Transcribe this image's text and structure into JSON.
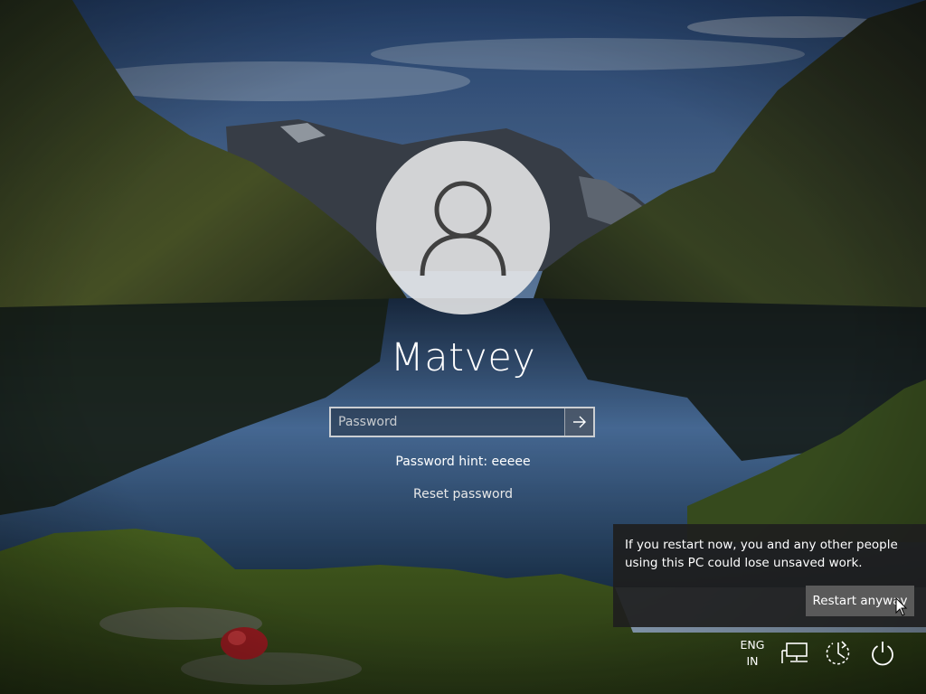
{
  "user": {
    "name": "Matvey"
  },
  "password_field": {
    "placeholder": "Password",
    "value": "",
    "submit_icon": "arrow-right-icon"
  },
  "password_hint": "Password hint: eeeee",
  "reset_password_label": "Reset password",
  "restart_dialog": {
    "message": "If you restart now, you and any other people\nusing this PC could lose unsaved work.",
    "button_label": "Restart anyway"
  },
  "tray": {
    "language_line1": "ENG",
    "language_line2": "IN",
    "icons": [
      "network-icon",
      "ease-of-access-icon",
      "power-icon"
    ]
  },
  "colors": {
    "dialog_bg": "#1e1e1e",
    "button_bg": "#5a5a5a",
    "text": "#ffffff"
  }
}
